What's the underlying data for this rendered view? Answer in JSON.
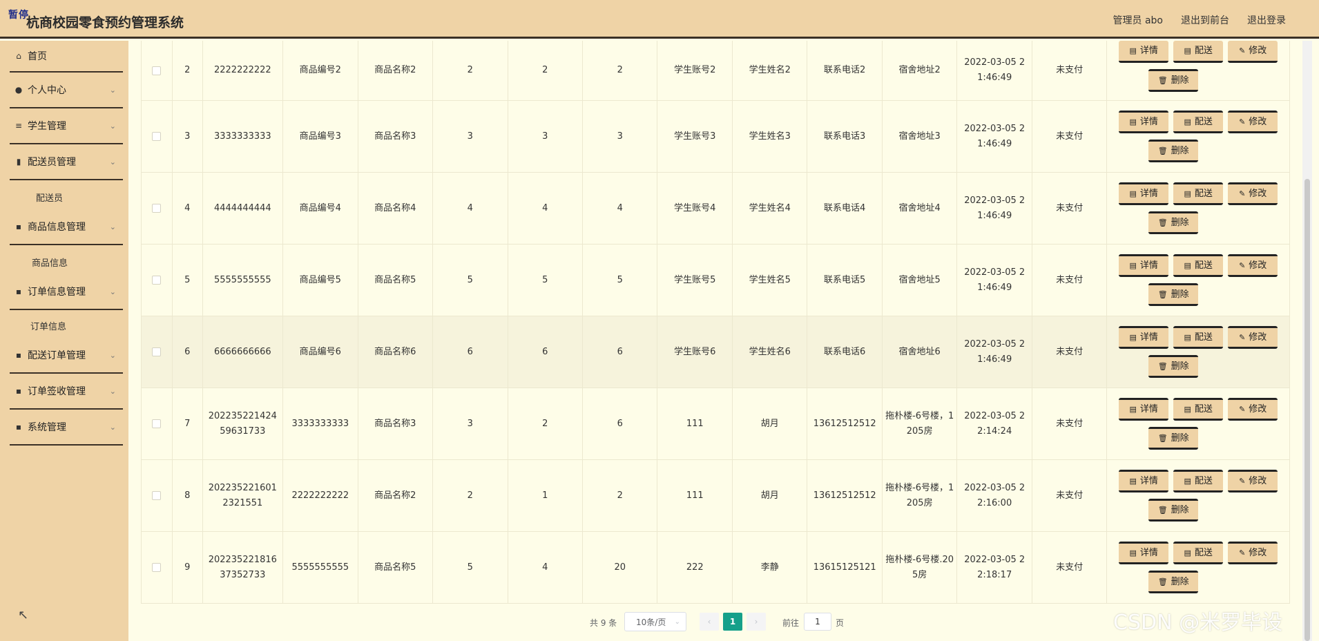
{
  "header": {
    "logo_tag": "暂停",
    "title": "杭商校园零食预约管理系统",
    "nav": [
      "管理员 abo",
      "退出到前台",
      "退出登录"
    ]
  },
  "sidebar": {
    "items": [
      {
        "label": "首页",
        "icon": "home-icon"
      },
      {
        "label": "个人中心",
        "icon": "user-icon"
      },
      {
        "label": "学生管理",
        "icon": "list-icon"
      },
      {
        "label": "配送员管理",
        "icon": "books-icon"
      },
      {
        "label": "配送员",
        "icon": ""
      },
      {
        "label": "商品信息管理",
        "icon": "grid-icon"
      },
      {
        "label": "商品信息",
        "icon": ""
      },
      {
        "label": "订单信息管理",
        "icon": "grid-icon"
      },
      {
        "label": "订单信息",
        "icon": ""
      },
      {
        "label": "配送订单管理",
        "icon": "grid-icon"
      },
      {
        "label": "订单签收管理",
        "icon": "grid-icon"
      },
      {
        "label": "系统管理",
        "icon": "grid-icon"
      }
    ]
  },
  "table": {
    "actions": {
      "detail": "详情",
      "deliver": "配送",
      "edit": "修改",
      "delete": "删除"
    },
    "rows": [
      {
        "idx": "2",
        "order": "2222222222",
        "goods_no": "商品编号2",
        "goods_name": "商品名称2",
        "n1": "2",
        "n2": "2",
        "n3": "2",
        "account": "学生账号2",
        "student": "学生姓名2",
        "phone": "联系电话2",
        "address": "宿舍地址2",
        "time": "2022-03-05 21:46:49",
        "pay": "未支付"
      },
      {
        "idx": "3",
        "order": "3333333333",
        "goods_no": "商品编号3",
        "goods_name": "商品名称3",
        "n1": "3",
        "n2": "3",
        "n3": "3",
        "account": "学生账号3",
        "student": "学生姓名3",
        "phone": "联系电话3",
        "address": "宿舍地址3",
        "time": "2022-03-05 21:46:49",
        "pay": "未支付"
      },
      {
        "idx": "4",
        "order": "4444444444",
        "goods_no": "商品编号4",
        "goods_name": "商品名称4",
        "n1": "4",
        "n2": "4",
        "n3": "4",
        "account": "学生账号4",
        "student": "学生姓名4",
        "phone": "联系电话4",
        "address": "宿舍地址4",
        "time": "2022-03-05 21:46:49",
        "pay": "未支付"
      },
      {
        "idx": "5",
        "order": "5555555555",
        "goods_no": "商品编号5",
        "goods_name": "商品名称5",
        "n1": "5",
        "n2": "5",
        "n3": "5",
        "account": "学生账号5",
        "student": "学生姓名5",
        "phone": "联系电话5",
        "address": "宿舍地址5",
        "time": "2022-03-05 21:46:49",
        "pay": "未支付"
      },
      {
        "idx": "6",
        "order": "6666666666",
        "goods_no": "商品编号6",
        "goods_name": "商品名称6",
        "n1": "6",
        "n2": "6",
        "n3": "6",
        "account": "学生账号6",
        "student": "学生姓名6",
        "phone": "联系电话6",
        "address": "宿舍地址6",
        "time": "2022-03-05 21:46:49",
        "pay": "未支付"
      },
      {
        "idx": "7",
        "order": "20223522142459631733",
        "goods_no": "3333333333",
        "goods_name": "商品名称3",
        "n1": "3",
        "n2": "2",
        "n3": "6",
        "account": "111",
        "student": "胡月",
        "phone": "13612512512",
        "address": "拖朴楼-6号楼，1205房",
        "time": "2022-03-05 22:14:24",
        "pay": "未支付"
      },
      {
        "idx": "8",
        "order": "2022352216012321551",
        "goods_no": "2222222222",
        "goods_name": "商品名称2",
        "n1": "2",
        "n2": "1",
        "n3": "2",
        "account": "111",
        "student": "胡月",
        "phone": "13612512512",
        "address": "拖朴楼-6号楼，1205房",
        "time": "2022-03-05 22:16:00",
        "pay": "未支付"
      },
      {
        "idx": "9",
        "order": "20223522181637352733",
        "goods_no": "5555555555",
        "goods_name": "商品名称5",
        "n1": "5",
        "n2": "4",
        "n3": "20",
        "account": "222",
        "student": "李静",
        "phone": "13615125121",
        "address": "拖朴楼-6号楼.205房",
        "time": "2022-03-05 22:18:17",
        "pay": "未支付"
      }
    ]
  },
  "pager": {
    "total": "共 9 条",
    "page_size": "10条/页",
    "prev": "‹",
    "current": "1",
    "next": "›",
    "goto_label": "前往",
    "goto_value": "1",
    "page_unit": "页"
  },
  "watermark": "CSDN @米罗毕设",
  "colors": {
    "sidebar_bg": "#efd3a6",
    "main_bg": "#fefde8",
    "accent": "#15a08a"
  }
}
